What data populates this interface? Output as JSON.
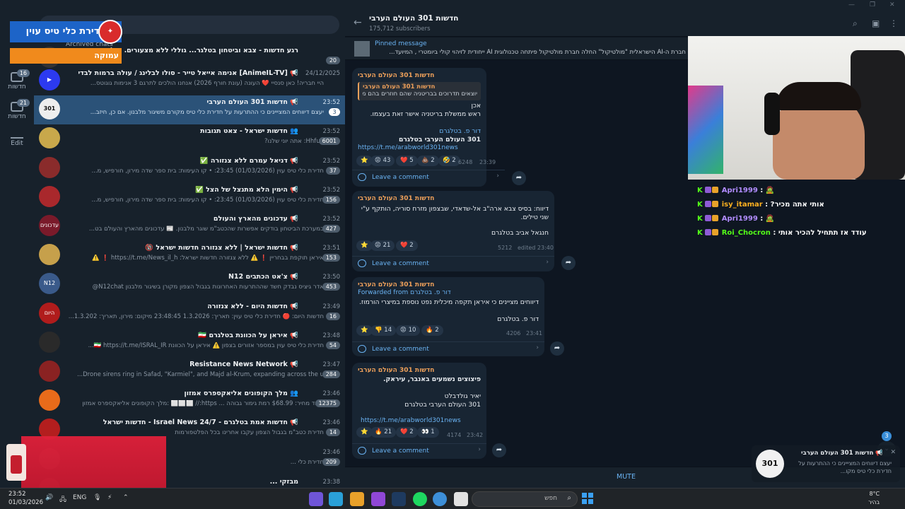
{
  "overlay": {
    "banner_top": "חדירת כלי טיס עוין",
    "banner_bottom": "עמוקה"
  },
  "rail": {
    "items": [
      {
        "label": "חדשות",
        "badge": "16"
      },
      {
        "label": "חדשות",
        "badge": "21"
      },
      {
        "label": "Edit",
        "badge": ""
      }
    ]
  },
  "chatlist": {
    "archived_label": "Archived chats",
    "rows": [
      {
        "title": "רגע חדשות - צבא וביטחון בטלגר... גוללי ללא מצעורים. קול החדשות אינו",
        "time": "",
        "msg": "",
        "badge": "20",
        "avatar": ""
      },
      {
        "title": "📢 [AnimeIL-TV] אנימה אייאל טייר - סולו לבלינג / עולה ברמות לבדי",
        "time": "24/12/2025",
        "msg": "היי חבריה! כאן סנסיי ❤️ העונה (עונת חורף 2026) אנחנו הולכים לתרגם 3 אנימות גוגוטס...",
        "badge": "",
        "avatar": "▶"
      },
      {
        "title": "📢 חדשות 301 העולם הערבי",
        "time": "23:52",
        "msg": "יעצם דיווחים המצייינים כי ההתרעות על חדירת כלי טיס מקורם משיגור מלבנון. אם כן, חיזב...",
        "badge": "3",
        "avatar": "301"
      },
      {
        "title": "👥 חדשות ישראל - צאט תגובות",
        "time": "23:52",
        "msg": "Hhfug: אתה יוני שלנו?",
        "badge": "6001",
        "avatar": ""
      },
      {
        "title": "📢 דניאל עמרם ללא צנזורה ✅",
        "time": "23:52",
        "msg": "חדירת כלי טיס עוין (01/03/2026) 23:45: • קו העימות: בית ספר שדה מירון, חורפיש, מ...",
        "badge": "37",
        "avatar": ""
      },
      {
        "title": "📢 הימין הלא מתנצל של הצל ✅",
        "time": "23:52",
        "msg": "חדירת כלי טיס עוין (01/03/2026) 23:45: • קו העימות: בית ספר שדה מירון, חורפיש, מ...",
        "badge": "156",
        "avatar": ""
      },
      {
        "title": "📢 עדכונים מהארץ והעולם",
        "time": "23:52",
        "msg": "במערכת הביטחון בודקים אפשרות שהכטב\"מ שוגר מלבנון. 📰 עדכונים מהארץ והעולם בט...",
        "badge": "427",
        "avatar": "עדכונים"
      },
      {
        "title": "📢 חדשות ישראל | ללא צנזורה חדשות ישראל 🔞",
        "time": "23:51",
        "msg": "איראן תוקפת בבחריין ❗ ⚠️ ללא צנזורה חדשות ישראל: https://t.me/News_il_h ❗ ⚠️",
        "badge": "153",
        "avatar": ""
      },
      {
        "title": "📢 צ'אט הכתבים N12",
        "time": "23:50",
        "msg": "אדר גיציס נבדק חשד שההתרעות האחרונות בגבול הצפון מקורן בשיגור מלבנון N12chat@",
        "badge": "453",
        "avatar": "N12"
      },
      {
        "title": "📢 חדשות היום - ללא צנזורה",
        "time": "23:49",
        "msg": "חדשות היום: 🔴 חדירת כלי טיס עוין: תאריך: 1.3.2026 23:48:45 מיקום: מירון, תאריך: 1.3.202...",
        "badge": "16",
        "avatar": "היום"
      },
      {
        "title": "📢 איראן על הכוונת בטלגרם 🇮🇷",
        "time": "23:48",
        "msg": "חדירת כלי טיס עוין במספר אזורים בצפון ⚠️ איראן על הכוונת 🇮🇷 https://t.me/ISRAL_IR...",
        "badge": "54",
        "avatar": ""
      },
      {
        "title": "📢 Resistance News Network",
        "time": "23:47",
        "msg": "Drone sirens ring in Safad, \"Karmiel\", and Majd al-Krum, expanding across the u...",
        "badge": "284",
        "avatar": ""
      },
      {
        "title": "👥 מלך הקופונים אליאקספרס אמזון",
        "time": "23:46",
        "msg": "ביגוד מחיר: $68.99 רמת גימור גבוהה ... https:// ⬜⬜⬜ :מלך הקופונים אליאקספרס אמזון",
        "badge": "12375",
        "avatar": ""
      },
      {
        "title": "📢 חדשות אמת בטלגרם - Israel News 24/7 - חדשות ישראל",
        "time": "23:46",
        "msg": "חדירת כטב\"מ בגבול הצפון עקבו אחרינו בכל הפלטפורמות",
        "badge": "14",
        "avatar": ""
      },
      {
        "title": "",
        "time": "23:46",
        "msg": "חדירת כלי ...",
        "badge": "209",
        "avatar": ""
      },
      {
        "title": "מבזקי ...",
        "time": "23:38",
        "msg": "",
        "badge": "",
        "avatar": ""
      }
    ]
  },
  "channel": {
    "title": "חדשות 301 העולם הערבי",
    "subscribers": "175,712 subscribers",
    "pinned_label": "Pinned message",
    "pinned_text": "חברת ה-AI הישראלית \"מולטיקול\" החלה חברת מולטיקול פיתחה טכנולוגית AI ייחודית לזיהוי קולי ביומטרי , המיועד...",
    "mute_label": "MUTE"
  },
  "messages": [
    {
      "from": "חדשות 301 העולם הערבי",
      "quote_from": "חדשות 301 העולם הערבי",
      "quote_text": "יוצאים תדרוכים בבריטניה שהם חוזרים בהם מה...",
      "lines": [
        "אכן",
        "ראש ממשלת בריטניה אישר זאת בעצמו."
      ],
      "sig1": "דור פ. בטלגרם",
      "sig2": "301 העולם הערבי בטלגרם",
      "link": "https://t.me/arabworld301news",
      "reactions": [
        "⭐",
        "😡 43",
        "❤️ 5",
        "💩 2",
        "🤣 2"
      ],
      "views": "6248",
      "time": "23:39",
      "comment": "Leave a comment"
    },
    {
      "from": "חדשות 301 העולם הערבי",
      "lines": [
        "דיווח: בסיס צבא ארה\"ב אל-שדאדי, שבצפון מזרח סוריה, הותקף ע\"י",
        "שני טילים."
      ],
      "sig1": "חנגאל אביב בטלגרם",
      "reactions": [
        "⭐",
        "😡 21",
        "❤️ 2"
      ],
      "views": "5212",
      "time": "edited 23:40",
      "comment": "Leave a comment"
    },
    {
      "from": "חדשות 301 העולם הערבי",
      "forwarded": "Forwarded from",
      "forwarded_name": "דור פ. בטלגרם",
      "lines": [
        "דיווחים מציינים כי איראן תקפה מיכלית נפט נוספת במיצרי הורמוז."
      ],
      "sig1": "דור פ. בטלגרם",
      "reactions": [
        "⭐",
        "👎 14",
        "😡 10",
        "🔥 2"
      ],
      "views": "4206",
      "time": "23:41",
      "comment": "Leave a comment"
    },
    {
      "from": "חדשות 301 העולם הערבי",
      "lines": [
        "פיצוצים נשמעים באנבר, עיראק."
      ],
      "sig1": "יאיר גולדבלט",
      "sig2": "301 העולם הערבי בטלגרם",
      "link": "https://t.me/arabworld301news",
      "reactions": [
        "⭐",
        "🔥 21",
        "❤️ 2",
        "👀 1"
      ],
      "views": "4174",
      "time": "23:42",
      "comment": "Leave a comment"
    }
  ],
  "stream_chat": [
    {
      "user": "Apri1999",
      "sep": ":",
      "text": "🧟",
      "color": "#b18cff"
    },
    {
      "user": "isy_itamar",
      "sep": ":",
      "text": "?אותי אתה מכיר",
      "color": "#ffb020"
    },
    {
      "user": "Apri1999",
      "sep": ":",
      "text": "🧟",
      "color": "#b18cff"
    },
    {
      "user": "Roi_Chocron",
      "sep": ":",
      "text": "עודד אז תתחיל להכיר אותי",
      "color": "#53fc18"
    }
  ],
  "notification": {
    "title": "📢 חדשות 301 העולם הערבי",
    "text": "יעצם דיווחים המצייינים כי ההתרעות על חדירת כלי טיס מקו...",
    "avatar": "301",
    "badge": "3"
  },
  "taskbar": {
    "time": "23:52",
    "date": "01/03/2026",
    "lang": "ENG",
    "search_placeholder": "חפש",
    "temp": "8°C",
    "weather": "בהיר"
  },
  "colors": {
    "bg": "#0e1621",
    "panel": "#17212b",
    "active": "#2b5278",
    "accent": "#6ab3f3",
    "author": "#eea05a"
  }
}
